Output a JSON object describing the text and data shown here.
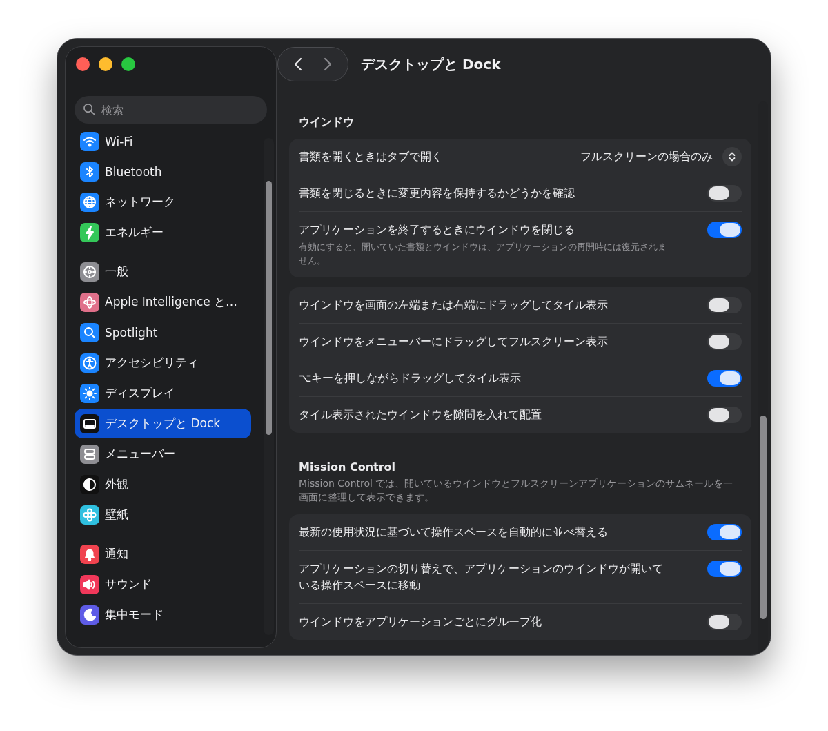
{
  "window": {
    "title": "デスクトップと Dock"
  },
  "sidebar": {
    "search": {
      "placeholder": "検索"
    },
    "groups": [
      [
        {
          "label": "Wi-Fi",
          "kind": "wifi",
          "color": "#1a84ff",
          "selected": false
        },
        {
          "label": "Bluetooth",
          "kind": "bluetooth",
          "color": "#1a84ff",
          "selected": false
        },
        {
          "label": "ネットワーク",
          "kind": "globe",
          "color": "#1a84ff",
          "selected": false
        },
        {
          "label": "エネルギー",
          "kind": "bolt",
          "color": "#34c759",
          "selected": false
        }
      ],
      [
        {
          "label": "一般",
          "kind": "gear",
          "color": "#8e8e93",
          "selected": false
        },
        {
          "label": "Apple Intelligence と…",
          "kind": "sparkle",
          "color": "#e0708a",
          "selected": false
        },
        {
          "label": "Spotlight",
          "kind": "search",
          "color": "#1a84ff",
          "selected": false
        },
        {
          "label": "アクセシビリティ",
          "kind": "person",
          "color": "#1a84ff",
          "selected": false
        },
        {
          "label": "ディスプレイ",
          "kind": "sun",
          "color": "#1a84ff",
          "selected": false
        },
        {
          "label": "デスクトップと Dock",
          "kind": "dock",
          "color": "#111111",
          "selected": true
        },
        {
          "label": "メニューバー",
          "kind": "switches",
          "color": "#8e8e93",
          "selected": false
        },
        {
          "label": "外観",
          "kind": "contrast",
          "color": "#111111",
          "selected": false
        },
        {
          "label": "壁紙",
          "kind": "flower",
          "color": "#2fc0e0",
          "selected": false
        }
      ],
      [
        {
          "label": "通知",
          "kind": "bell",
          "color": "#f0434f",
          "selected": false
        },
        {
          "label": "サウンド",
          "kind": "speaker",
          "color": "#f0385a",
          "selected": false
        },
        {
          "label": "集中モード",
          "kind": "moon",
          "color": "#5e5ce6",
          "selected": false
        }
      ]
    ]
  },
  "sections": [
    {
      "title": "ウインドウ",
      "cards": [
        [
          {
            "kind": "popup",
            "label": "書類を開くときはタブで開く",
            "value": "フルスクリーンの場合のみ"
          },
          {
            "kind": "toggle",
            "label": "書類を閉じるときに変更内容を保持するかどうかを確認",
            "on": false
          },
          {
            "kind": "toggle",
            "label": "アプリケーションを終了するときにウインドウを閉じる",
            "description": "有効にすると、開いていた書類とウインドウは、アプリケーションの再開時には復元されません。",
            "on": true
          }
        ],
        [
          {
            "kind": "toggle",
            "label": "ウインドウを画面の左端または右端にドラッグしてタイル表示",
            "on": false
          },
          {
            "kind": "toggle",
            "label": "ウインドウをメニューバーにドラッグしてフルスクリーン表示",
            "on": false
          },
          {
            "kind": "toggle",
            "label": "⌥キーを押しながらドラッグしてタイル表示",
            "on": true
          },
          {
            "kind": "toggle",
            "label": "タイル表示されたウインドウを隙間を入れて配置",
            "on": false
          }
        ]
      ]
    },
    {
      "title": "Mission Control",
      "description": "Mission Control では、開いているウインドウとフルスクリーンアプリケーションのサムネールを一画面に整理して表示できます。",
      "cards": [
        [
          {
            "kind": "toggle",
            "label": "最新の使用状況に基づいて操作スペースを自動的に並べ替える",
            "on": true
          },
          {
            "kind": "toggle",
            "label": "アプリケーションの切り替えで、アプリケーションのウインドウが開いている操作スペースに移動",
            "on": true
          },
          {
            "kind": "toggle",
            "label": "ウインドウをアプリケーションごとにグループ化",
            "on": false
          }
        ]
      ]
    }
  ]
}
